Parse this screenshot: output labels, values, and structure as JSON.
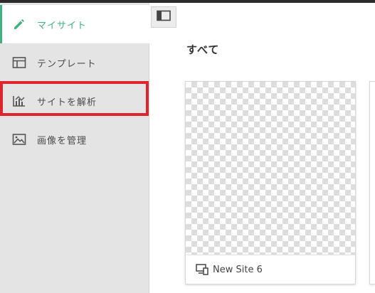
{
  "sidebar": {
    "items": [
      {
        "label": "マイサイト",
        "icon": "pencil-icon",
        "active": true
      },
      {
        "label": "テンプレート",
        "icon": "template-icon",
        "active": false
      },
      {
        "label": "サイトを解析",
        "icon": "analytics-chart-icon",
        "active": false
      },
      {
        "label": "画像を管理",
        "icon": "image-icon",
        "active": false
      }
    ]
  },
  "main": {
    "section_title": "すべて",
    "sites": [
      {
        "name": "New Site 6",
        "device_icon": "responsive-device-icon"
      }
    ]
  },
  "colors": {
    "accent": "#3fb27f",
    "highlight": "#e0242f",
    "sidebar_bg": "#e4e4e4"
  }
}
